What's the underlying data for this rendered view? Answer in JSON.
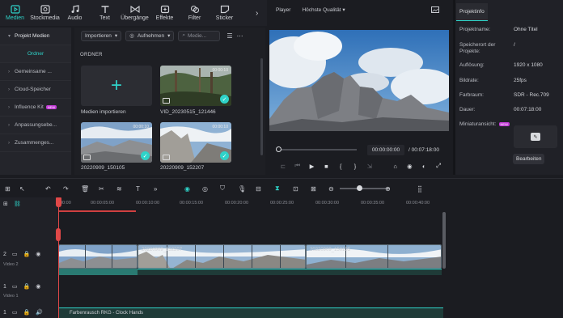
{
  "colors": {
    "accent": "#2fd3c9",
    "playhead": "#e04848",
    "new_badge": "#c23bd6"
  },
  "top_tabs": [
    {
      "label": "Medien",
      "icon": "media-icon",
      "active": true
    },
    {
      "label": "Stockmedia",
      "icon": "stock-icon"
    },
    {
      "label": "Audio",
      "icon": "music-icon"
    },
    {
      "label": "Text",
      "icon": "text-icon"
    },
    {
      "label": "Übergänge",
      "icon": "transition-icon"
    },
    {
      "label": "Effekte",
      "icon": "effects-icon"
    },
    {
      "label": "Filter",
      "icon": "filter-icon"
    },
    {
      "label": "Sticker",
      "icon": "sticker-icon"
    }
  ],
  "left_nav": {
    "project_media": "Projekt Medien",
    "folder": "Ordner",
    "items": [
      "Gemeinsame ...",
      "Cloud-Speicher",
      "Influence Kit",
      "Anpassungsebe...",
      "Zusammenges..."
    ],
    "new_badge": "NEW"
  },
  "media": {
    "import_btn": "Importieren",
    "record_btn": "Aufnehmen",
    "search_placeholder": "Medie...",
    "folder_label": "ORDNER",
    "tiles": [
      {
        "label": "Medien importieren"
      },
      {
        "label": "VID_20230515_121446",
        "duration": "00:00:10"
      },
      {
        "label": "20220909_150105",
        "duration": "00:00:10"
      },
      {
        "label": "20220909_152207",
        "duration": "00:00:10"
      }
    ]
  },
  "player": {
    "tab": "Player",
    "quality": "Höchste Qualität",
    "current_time": "00:00:00:00",
    "separator": "/",
    "total_time": "00:07:18:00",
    "controls": [
      "⊏",
      "⏮",
      "▶",
      "■",
      "{",
      "}",
      "⇲",
      "⌂",
      "◉",
      "◐",
      "⤢"
    ]
  },
  "project_info": {
    "tab": "Projektinfo",
    "rows": [
      {
        "k": "Projektname:",
        "v": "Ohne Titel"
      },
      {
        "k": "Speicherort der Projekte:",
        "v": "/"
      },
      {
        "k": "Auflösung:",
        "v": "1920 x 1080"
      },
      {
        "k": "Bildrate:",
        "v": "25fps"
      },
      {
        "k": "Farbraum:",
        "v": "SDR - Rec.709"
      },
      {
        "k": "Dauer:",
        "v": "00:07:18:00"
      },
      {
        "k": "Miniaturansicht:",
        "v": ""
      }
    ],
    "edit_btn": "Bearbeiten"
  },
  "timeline": {
    "ruler": [
      "00:00",
      "00:00:05:00",
      "00:00:10:00",
      "00:00:15:00",
      "00:00:20:00",
      "00:00:25:00",
      "00:00:30:00",
      "00:00:35:00",
      "00:00:40:00"
    ],
    "tracks": [
      {
        "label": "Video 2",
        "num": "2"
      },
      {
        "label": "Video 1",
        "num": "1"
      },
      {
        "label": "",
        "num": "1"
      }
    ],
    "clip_labels": [
      "20220909_152207",
      "20220909_150105"
    ],
    "audio_clip_label": "Farbenrausch RKG - Clock Hands"
  }
}
